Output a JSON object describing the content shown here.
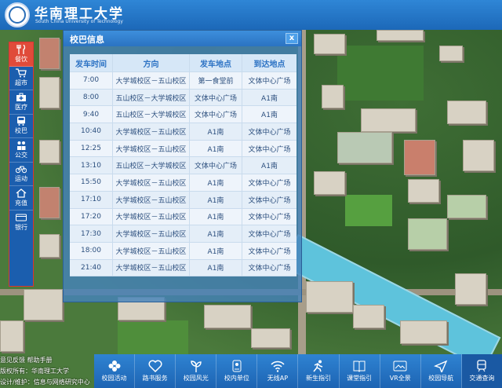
{
  "header": {
    "title": "华南理工大学",
    "subtitle": "South China University of Technology"
  },
  "sidebar": {
    "items": [
      {
        "label": "餐饮",
        "icon": "fork-knife-icon",
        "active": true
      },
      {
        "label": "超市",
        "icon": "cart-icon"
      },
      {
        "label": "医疗",
        "icon": "medical-kit-icon"
      },
      {
        "label": "校巴",
        "icon": "bus-icon"
      },
      {
        "label": "公交",
        "icon": "people-icon"
      },
      {
        "label": "运动",
        "icon": "bicycle-icon"
      },
      {
        "label": "充值",
        "icon": "house-icon"
      },
      {
        "label": "银行",
        "icon": "card-icon"
      }
    ]
  },
  "dialog": {
    "title": "校巴信息",
    "close": "x",
    "columns": [
      "发车时间",
      "方向",
      "发车地点",
      "到达地点"
    ],
    "rows": [
      [
        "7:00",
        "大学城校区－五山校区",
        "第一食堂前",
        "文体中心广场"
      ],
      [
        "8:00",
        "五山校区－大学城校区",
        "文体中心广场",
        "A1南"
      ],
      [
        "9:40",
        "五山校区－大学城校区",
        "文体中心广场",
        "A1南"
      ],
      [
        "10:40",
        "大学城校区－五山校区",
        "A1南",
        "文体中心广场"
      ],
      [
        "12:25",
        "大学城校区－五山校区",
        "A1南",
        "文体中心广场"
      ],
      [
        "13:10",
        "五山校区－大学城校区",
        "文体中心广场",
        "A1南"
      ],
      [
        "15:50",
        "大学城校区－五山校区",
        "A1南",
        "文体中心广场"
      ],
      [
        "17:10",
        "大学城校区－五山校区",
        "A1南",
        "文体中心广场"
      ],
      [
        "17:20",
        "大学城校区－五山校区",
        "A1南",
        "文体中心广场"
      ],
      [
        "17:30",
        "大学城校区－五山校区",
        "A1南",
        "文体中心广场"
      ],
      [
        "18:00",
        "大学城校区－五山校区",
        "A1南",
        "文体中心广场"
      ],
      [
        "21:40",
        "大学城校区－五山校区",
        "A1南",
        "文体中心广场"
      ]
    ]
  },
  "bottom_bar": {
    "items": [
      {
        "label": "校园活动",
        "icon": "flower-icon"
      },
      {
        "label": "路书服务",
        "icon": "heart-icon"
      },
      {
        "label": "校园风光",
        "icon": "plant-icon"
      },
      {
        "label": "校内单位",
        "icon": "map-pin-icon"
      },
      {
        "label": "无线AP",
        "icon": "wifi-icon"
      },
      {
        "label": "新生指引",
        "icon": "runner-icon"
      },
      {
        "label": "课堂指引",
        "icon": "book-icon"
      },
      {
        "label": "VR全景",
        "icon": "vr-icon"
      },
      {
        "label": "校园导航",
        "icon": "navigation-icon"
      },
      {
        "label": "交通查询",
        "icon": "subway-icon"
      }
    ]
  },
  "footer": {
    "line1": "意见反馈  帮助手册",
    "line2": "版权所有：华南理工大学",
    "line3": "设计/维护：信息与网络研究中心"
  },
  "colors": {
    "accent": "#2b73c2",
    "active": "#e04b3a",
    "river": "#5ec3dc"
  }
}
